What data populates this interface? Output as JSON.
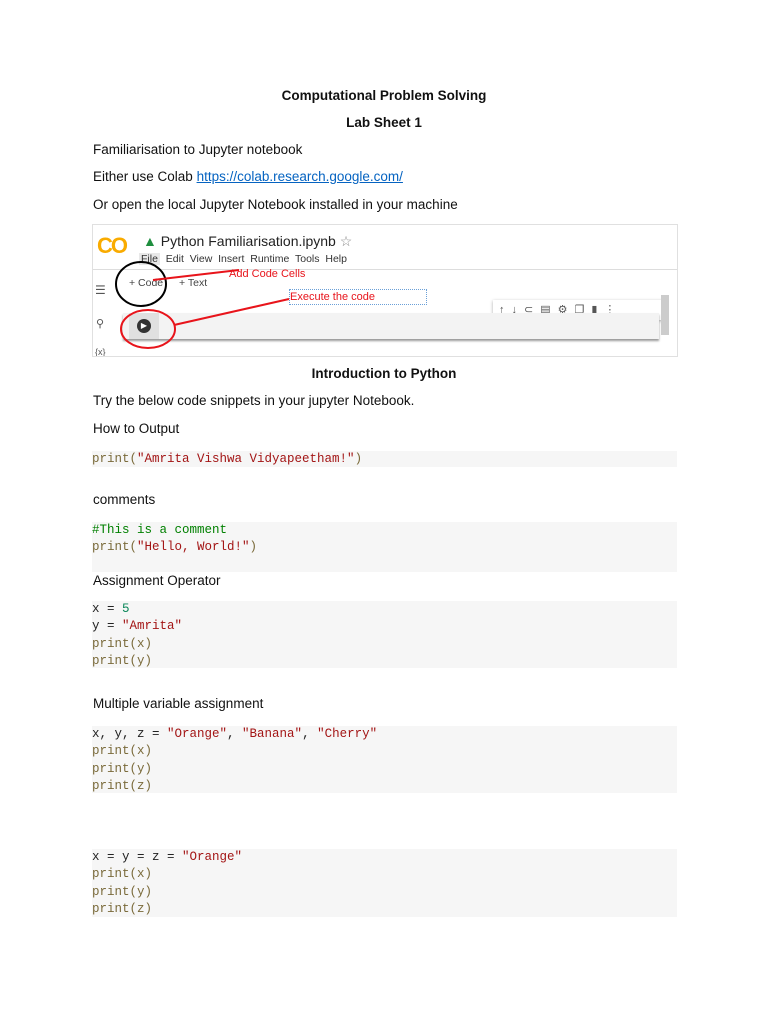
{
  "title": "Computational Problem Solving",
  "subtitle": "Lab Sheet 1",
  "intro": {
    "line1": "Familiarisation to Jupyter notebook",
    "line2_prefix": "Either use Colab ",
    "line2_link": "https://colab.research.google.com/",
    "line3": "Or open the local Jupyter Notebook installed in your machine"
  },
  "screenshot": {
    "logo": "CO",
    "filename": "Python Familiarisation.ipynb",
    "menu": [
      "File",
      "Edit",
      "View",
      "Insert",
      "Runtime",
      "Tools",
      "Help"
    ],
    "add_code": "+ Code",
    "add_text": "+ Text",
    "annotation_add": "Add Code Cells",
    "annotation_exec": "Execute the code",
    "sidebar_var": "{x}"
  },
  "section2": "Introduction to Python",
  "try_text": "Try the below code snippets in your jupyter Notebook.",
  "labels": {
    "output": "How to Output",
    "comments": "comments",
    "assign": "Assignment Operator",
    "multi": "Multiple variable assignment"
  },
  "code": {
    "b1": {
      "fn": "print(",
      "str": "\"Amrita Vishwa Vidyapeetham!\"",
      "end": ")"
    },
    "b2": {
      "comment": "#This is a comment",
      "fn": "print(",
      "str": "\"Hello, World!\"",
      "end": ")"
    },
    "b3": {
      "l1a": "x = ",
      "l1b": "5",
      "l2a": "y = ",
      "l2b": "\"Amrita\"",
      "l3": "print(x)",
      "l4": "print(y)"
    },
    "b4": {
      "l1a": "x, y, z = ",
      "s1": "\"Orange\"",
      "s2": "\"Banana\"",
      "s3": "\"Cherry\"",
      "sep": ", ",
      "l2": "print(x)",
      "l3": "print(y)",
      "l4": "print(z)"
    },
    "b5": {
      "l1a": "x = y = z = ",
      "s1": "\"Orange\"",
      "l2": "print(x)",
      "l3": "print(y)",
      "l4": "print(z)"
    }
  },
  "colors": {
    "function": "#7a6a3a",
    "string": "#a31515",
    "number": "#098658",
    "comment": "#008000",
    "link": "#0563c1",
    "annotation": "#e8141b"
  }
}
